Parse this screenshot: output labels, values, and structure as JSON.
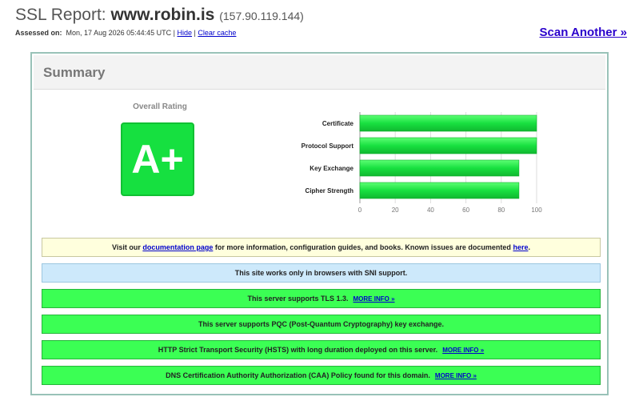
{
  "header": {
    "title_prefix": "SSL Report:",
    "host": "www.robin.is",
    "ip": "(157.90.119.144)",
    "assessed_label": "Assessed on:",
    "assessed_value": "Mon, 17 Aug 2026 05:44:45 UTC |",
    "hide_link": "Hide",
    "separator": "|",
    "clear_cache_link": "Clear cache",
    "scan_another": "Scan Another »"
  },
  "summary": {
    "title": "Summary",
    "overall_rating_label": "Overall Rating",
    "grade": "A+",
    "grade_color": "#16e040"
  },
  "chart_data": {
    "type": "bar",
    "orientation": "horizontal",
    "categories": [
      "Certificate",
      "Protocol Support",
      "Key Exchange",
      "Cipher Strength"
    ],
    "values": [
      100,
      100,
      90,
      90
    ],
    "xlim": [
      0,
      100
    ],
    "ticks": [
      "0",
      "20",
      "40",
      "60",
      "80",
      "100"
    ],
    "grid": true,
    "bar_color": "#18e040"
  },
  "notices": [
    {
      "text_before": "Visit our",
      "link1": "documentation page",
      "text_middle": "for more information, configuration guides, and books. Known issues are documented",
      "link2": "here",
      "text_after": "."
    },
    {
      "text": "This site works only in browsers with SNI support."
    },
    {
      "text": "This server supports TLS 1.3.",
      "more": "MORE INFO »"
    },
    {
      "text": "This server supports PQC (Post-Quantum Cryptography) key exchange."
    },
    {
      "text": "HTTP Strict Transport Security (HSTS) with long duration deployed on this server.",
      "more": "MORE INFO »"
    },
    {
      "text": "DNS Certification Authority Authorization (CAA) Policy found for this domain.",
      "more": "MORE INFO »"
    }
  ]
}
